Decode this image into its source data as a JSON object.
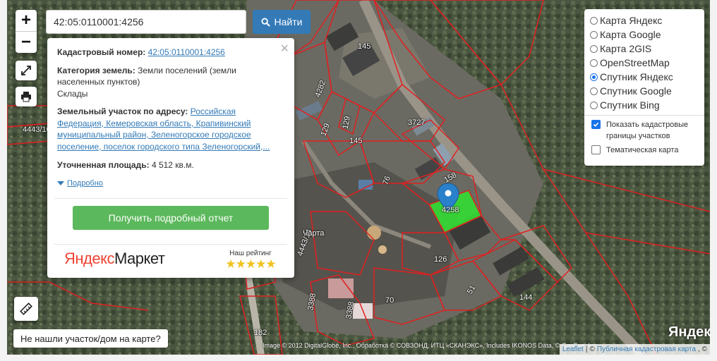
{
  "search": {
    "value": "42:05:0110001:4256",
    "button_label": "Найти"
  },
  "zoom": {
    "in": "+",
    "out": "−"
  },
  "popup": {
    "cadastral_label": "Кадастровый номер:",
    "cadastral_value": "42:05:0110001:4256",
    "category_label": "Категория земель:",
    "category_value": "Земли поселений (земли населенных пунктов)",
    "use_value": "Склады",
    "address_label": "Земельный участок по адресу:",
    "address_value": "Российская Федерация, Кемеровская область, Крапивинский муниципальный район, Зеленогорское городское поселение, поселок городского типа Зеленогорский,...",
    "area_label": "Уточненная площадь:",
    "area_value": "4 512 кв.м.",
    "more_label": "Подробно",
    "report_button": "Получить подробный отчет",
    "market_yandex": "Яндекс",
    "market_name": "Маркет",
    "rating_label": "Наш рейтинг",
    "rating_stars": "★★★★★",
    "close_symbol": "×"
  },
  "layers": {
    "base_options": [
      "Карта Яндекс",
      "Карта Google",
      "Карта 2GIS",
      "OpenStreetMap",
      "Спутник Яндекс",
      "Спутник Google",
      "Спутник Bing"
    ],
    "selected": "Спутник Яндекс",
    "overlays": [
      {
        "label": "Показать кадастровые границы участков",
        "checked": true
      },
      {
        "label": "Тематическая карта",
        "checked": false
      }
    ]
  },
  "not_found_button": "Не нашли участок/дом на карте?",
  "attribution": {
    "imagery": "Image © 2012 DigitalGlobe, Inc., Обработка © СОВЗОНД, ИТЦ «СКАНЭКС», Includes IKONOS Data, © GeoEye, Inc.",
    "leaflet": "Leaflet",
    "sep": "|",
    "copyright_sign": "©",
    "pkk": "Публичная кадастровая карта",
    "trailing": ", ©"
  },
  "yandex_logo": "Яндекс",
  "parcel_labels": [
    "145",
    "4282",
    "3727",
    "129",
    "129",
    "145",
    "158",
    "76",
    "126",
    "4258",
    "70",
    "51",
    "144",
    "3388",
    "3388",
    "182",
    "4443/14",
    "4443/10",
    "Чарта"
  ],
  "colors": {
    "parcel_border": "#e02020",
    "selected_parcel": "#33dd33",
    "search_button": "#337ab7",
    "report_button": "#5cb85c",
    "marker": "#2a81cb"
  },
  "icons": {
    "search": "search-icon",
    "fullscreen": "fullscreen-icon",
    "print": "print-icon",
    "ruler": "ruler-icon",
    "marker": "map-marker-icon"
  }
}
